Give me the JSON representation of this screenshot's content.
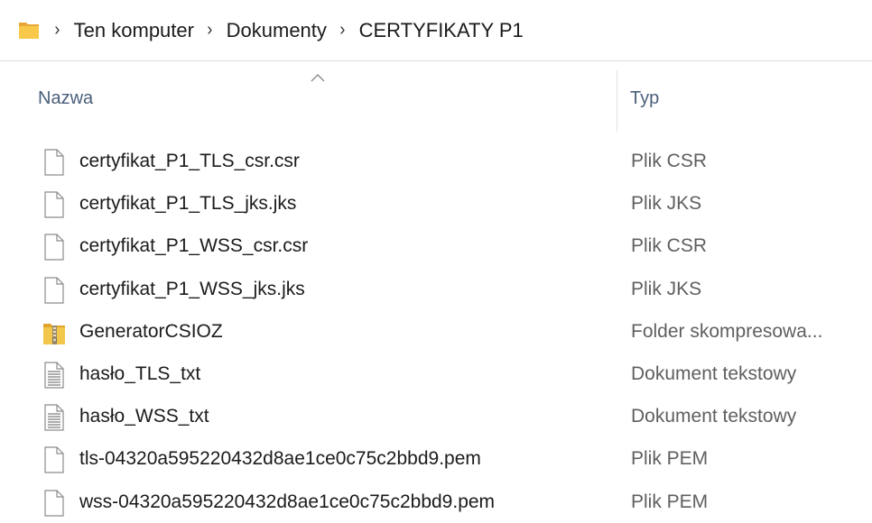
{
  "breadcrumb": {
    "root_icon": "folder-icon",
    "items": [
      "Ten komputer",
      "Dokumenty",
      "CERTYFIKATY P1"
    ]
  },
  "columns": {
    "name": "Nazwa",
    "type": "Typ",
    "sort_indicator": "sort-ascending-icon"
  },
  "files": [
    {
      "name": "certyfikat_P1_TLS_csr.csr",
      "type": "Plik CSR",
      "icon": "blank-file-icon"
    },
    {
      "name": "certyfikat_P1_TLS_jks.jks",
      "type": "Plik JKS",
      "icon": "blank-file-icon"
    },
    {
      "name": "certyfikat_P1_WSS_csr.csr",
      "type": "Plik CSR",
      "icon": "blank-file-icon"
    },
    {
      "name": "certyfikat_P1_WSS_jks.jks",
      "type": "Plik JKS",
      "icon": "blank-file-icon"
    },
    {
      "name": "GeneratorCSIOZ",
      "type": "Folder skompresowa...",
      "icon": "zip-folder-icon"
    },
    {
      "name": "hasło_TLS_txt",
      "type": "Dokument tekstowy",
      "icon": "text-file-icon"
    },
    {
      "name": "hasło_WSS_txt",
      "type": "Dokument tekstowy",
      "icon": "text-file-icon"
    },
    {
      "name": "tls-04320a595220432d8ae1ce0c75c2bbd9.pem",
      "type": "Plik PEM",
      "icon": "blank-file-icon"
    },
    {
      "name": "wss-04320a595220432d8ae1ce0c75c2bbd9.pem",
      "type": "Plik PEM",
      "icon": "blank-file-icon"
    }
  ],
  "colors": {
    "folder_yellow": "#f8c84a",
    "header_text": "#4a5f7a",
    "zip_yellow": "#f0c040"
  }
}
